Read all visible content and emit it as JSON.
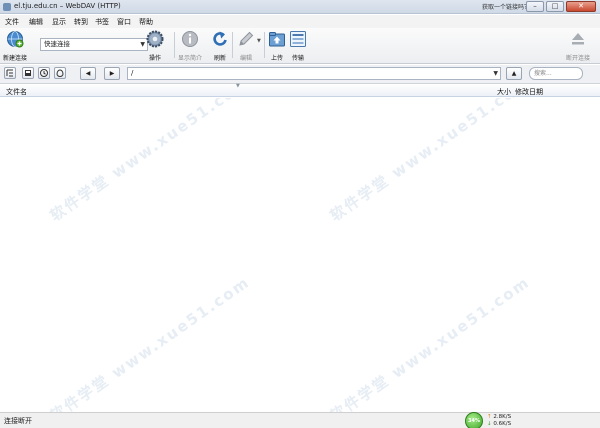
{
  "window": {
    "title": "el.tju.edu.cn – WebDAV (HTTP)",
    "hint": "获取一个链接吗？",
    "min_label": "–",
    "max_label": "□",
    "close_label": "✕"
  },
  "menu": [
    "文件",
    "编辑",
    "显示",
    "转到",
    "书签",
    "窗口",
    "帮助"
  ],
  "toolbar": {
    "new_connection": "新建连接",
    "quick_connect": "快速连接",
    "action": "操作",
    "info": "显示简介",
    "refresh": "刷新",
    "edit": "编辑",
    "upload": "上传",
    "transfers": "传输",
    "disconnect": "断开连接"
  },
  "pathbar": {
    "back": "◀",
    "forward": "▶",
    "path": "/",
    "up": "▲",
    "search_placeholder": "搜索..."
  },
  "columns": {
    "name": "文件名",
    "size": "大小",
    "modified": "修改日期"
  },
  "watermark": "软件学堂 www.xue51.com",
  "status": {
    "text": "连接断开",
    "net_percent": "34%",
    "upload_speed": "2.8K/S",
    "download_speed": "0.6K/S"
  },
  "colors": {
    "accent": "#2f6fb5",
    "status_green": "#3ca523"
  },
  "icons": [
    "globe-icon",
    "gear-icon",
    "info-icon",
    "refresh-icon",
    "pencil-icon",
    "upload-icon",
    "transfers-icon",
    "eject-icon"
  ]
}
